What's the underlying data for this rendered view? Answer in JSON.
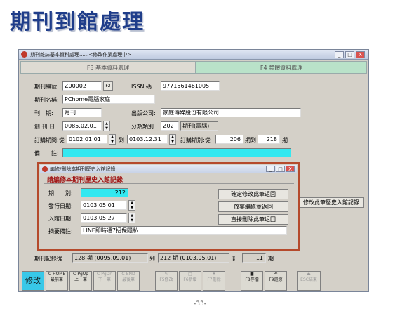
{
  "slide": {
    "title": "期刊到館處理",
    "page_number": "-33-"
  },
  "window": {
    "title": "期刊雜誌基本資料處理......<修改作業處理中>",
    "controls": [
      "_",
      "□",
      "X"
    ],
    "tabs": [
      {
        "label": "F3 基本資料處理"
      },
      {
        "label": "F4 整體資料處理"
      }
    ]
  },
  "form": {
    "journal_no_label": "期刊編號:",
    "journal_no": "Z00002",
    "f2": "F2",
    "issn_label": "ISSN 碼:",
    "issn": "9771561461005",
    "journal_name_label": "期刊名稱:",
    "journal_name": "PChome電腦家庭",
    "period_label": "刊　期:",
    "period": "月刊",
    "publisher_label": "出版公司:",
    "publisher": "家庭傳媒股份有限公司",
    "first_issue_label": "創 刊 日:",
    "first_issue": "0085.02.01",
    "category_label": "分類類別:",
    "category_code": "Z02",
    "category_name": "期刊(電腦)",
    "sub_period_label": "訂購期間:從",
    "sub_from": "0102.01.01",
    "to1": "到",
    "sub_to": "0103.12.31",
    "sub_issue_label": "訂購期別:從",
    "issue_from": "206",
    "issue_to_label": "期到",
    "issue_to": "218",
    "issue_unit": "期",
    "note_label": "備　　註:",
    "history_button": "修改此筆歷史入館記錄",
    "record_label": "期刊記錄從:",
    "rec_from": "128 期 (0095.09.01)",
    "rec_to_label": "到",
    "rec_to": "212 期 (0103.05.01)",
    "count_label": "計:",
    "count": "11",
    "count_unit": "期"
  },
  "dialog": {
    "title": "編修/刪除本期刊歷史入館記錄",
    "heading": "請編修本期刊歷史入館記錄",
    "issue_label": "期　　別:",
    "issue": "212",
    "publish_label": "發行日期:",
    "publish_date": "0103.05.01",
    "arrive_label": "入館日期:",
    "arrive_date": "0103.05.27",
    "memo_label": "摘要備註:",
    "memo": "LINE即時通7招保隱私",
    "btn_confirm": "確定修改此筆返回",
    "btn_cancel": "放棄編修並返回",
    "btn_delete": "直接刪除此筆返回"
  },
  "toolbar": [
    {
      "label": "修改",
      "sub": "",
      "enabled": true
    },
    {
      "label": "C-HOME",
      "sub": "最前筆",
      "enabled": true
    },
    {
      "label": "C-PgUp",
      "sub": "上一筆",
      "enabled": true
    },
    {
      "label": "C-PgDn",
      "sub": "下一筆",
      "enabled": false
    },
    {
      "label": "C-END",
      "sub": "最後筆",
      "enabled": false
    },
    {
      "label": "F5修改",
      "sub": "",
      "enabled": false
    },
    {
      "label": "F6新增",
      "sub": "",
      "enabled": false
    },
    {
      "label": "F7刪除",
      "sub": "",
      "enabled": false
    },
    {
      "label": "F8存檔",
      "sub": "",
      "enabled": true
    },
    {
      "label": "F9還原",
      "sub": "",
      "enabled": true
    },
    {
      "label": "ESC結束",
      "sub": "",
      "enabled": false
    }
  ],
  "colors": {
    "title_blue": "#1f3d8a",
    "dialog_border": "#b54a2c",
    "heading_red": "#a01414",
    "highlight_cyan": "#33e8f0",
    "tab_green": "#b9e2c9"
  }
}
